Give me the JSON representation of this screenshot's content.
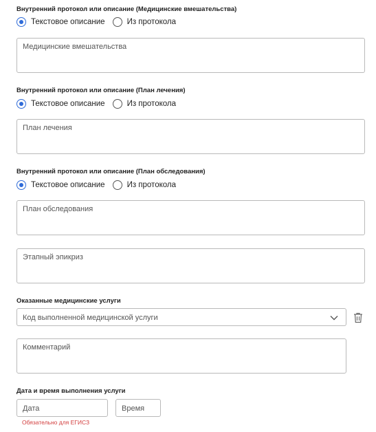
{
  "sections": [
    {
      "title": "Внутренний протокол или описание (Медицинские вмешательства)",
      "option_text": "Текстовое описание",
      "option_protocol": "Из протокола",
      "selected": "text",
      "field_placeholder": "Медицинские вмешательства"
    },
    {
      "title": "Внутренний протокол или описание (План лечения)",
      "option_text": "Текстовое описание",
      "option_protocol": "Из протокола",
      "selected": "text",
      "field_placeholder": "План лечения"
    },
    {
      "title": "Внутренний протокол или описание (План обследования)",
      "option_text": "Текстовое описание",
      "option_protocol": "Из протокола",
      "selected": "text",
      "field_placeholder": "План обследования"
    }
  ],
  "epicrisis": {
    "placeholder": "Этапный эпикриз"
  },
  "services": {
    "title": "Оказанные медицинские услуги",
    "code_select_placeholder": "Код выполненной медицинской услуги",
    "comment_placeholder": "Комментарий"
  },
  "datetime": {
    "title": "Дата и время выполнения услуги",
    "date_placeholder": "Дата",
    "time_placeholder": "Время",
    "required_hint": "Обязательно для ЕГИСЗ"
  },
  "icons": {
    "chevron": "chevron-down-icon",
    "delete": "trash-icon"
  },
  "colors": {
    "accent": "#2f6bd8",
    "error": "#d23b3b",
    "border": "#b9b9b9"
  }
}
